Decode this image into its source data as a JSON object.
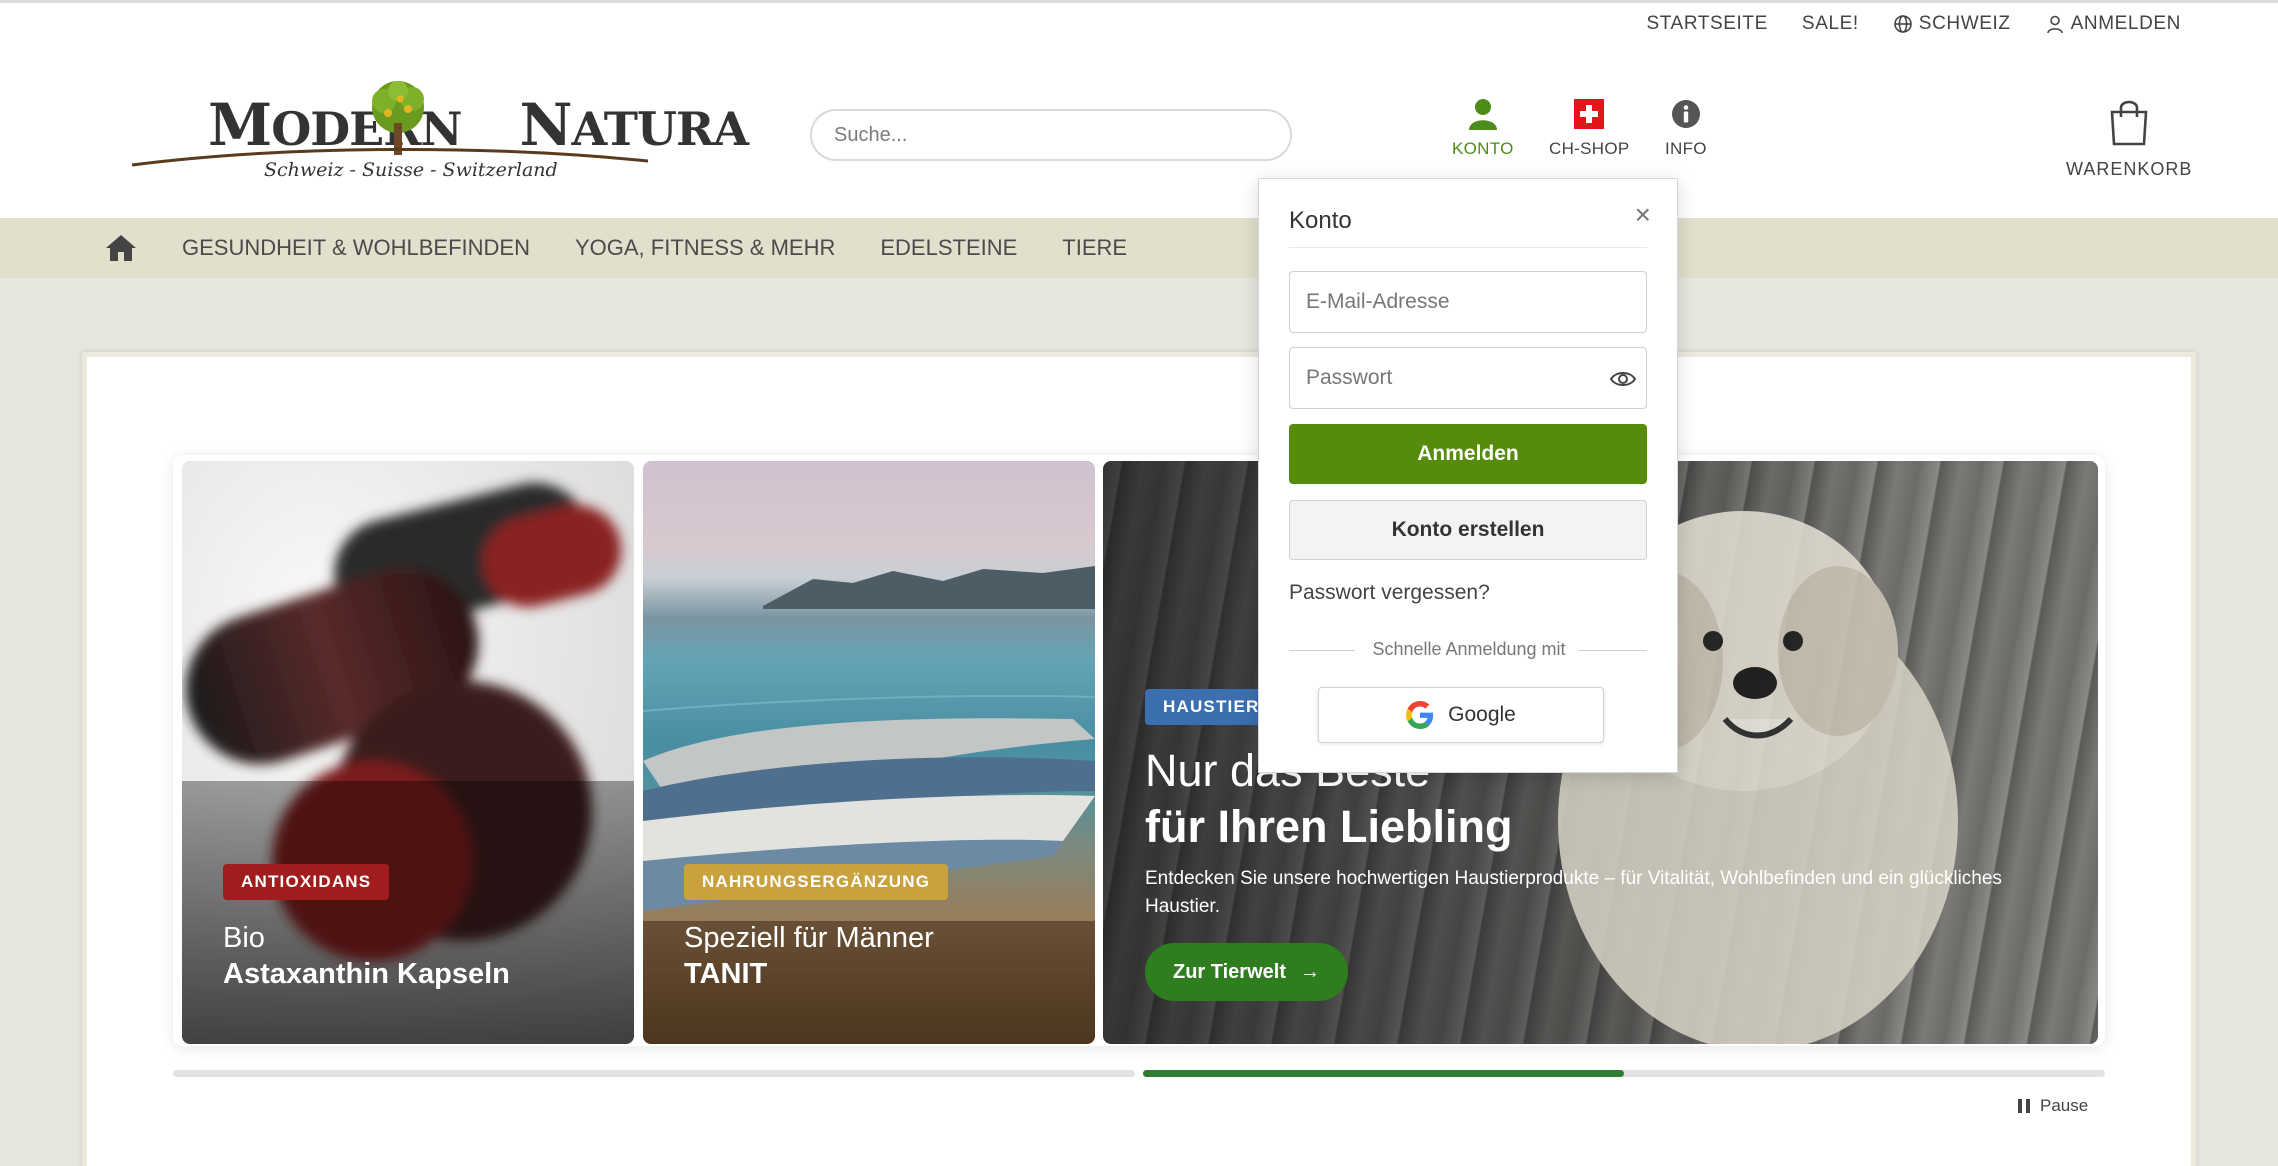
{
  "topbar": {
    "items": [
      {
        "label": "STARTSEITE",
        "icon": null
      },
      {
        "label": "SALE!",
        "icon": null
      },
      {
        "label": "SCHWEIZ",
        "icon": "globe-icon"
      },
      {
        "label": "ANMELDEN",
        "icon": "user-outline-icon"
      }
    ]
  },
  "logo": {
    "word1_cap": "M",
    "word1_rest": "ODERN",
    "word2_cap": "N",
    "word2_rest": "ATURA",
    "tagline": "Schweiz - Suisse - Switzerland"
  },
  "search": {
    "placeholder": "Suche..."
  },
  "header_icons": {
    "konto": {
      "label": "KONTO",
      "icon": "user-icon",
      "color": "#4b8c1a"
    },
    "chshop": {
      "label": "CH-SHOP",
      "icon": "swiss-flag-icon"
    },
    "info": {
      "label": "INFO",
      "icon": "info-icon"
    },
    "cart": {
      "label": "WARENKORB",
      "icon": "shopping-bag-icon"
    }
  },
  "nav": {
    "home_icon": "home-icon",
    "items": [
      "GESUNDHEIT & WOHLBEFINDEN",
      "YOGA, FITNESS & MEHR",
      "EDELSTEINE",
      "TIERE"
    ]
  },
  "slides": [
    {
      "badge": "ANTIOXIDANS",
      "badge_color": "#a11d1d",
      "line1": "Bio",
      "line2": "Astaxanthin Kapseln"
    },
    {
      "badge": "NAHRUNGSERGÄNZUNG",
      "badge_color": "#c9a23d",
      "line1": "Speziell für Männer",
      "line2": "TANIT"
    },
    {
      "badge": "HAUSTIER",
      "badge_color": "#3c6fb0",
      "line1": "Nur das Beste",
      "line2": "für Ihren Liebling",
      "text": "Entdecken Sie unsere hochwertigen Haustierprodukte – für Vitalität, Wohlbefinden und ein glückliches Haustier.",
      "cta": "Zur Tierwelt",
      "cta_arrow": "→",
      "cta_color": "#2e7d1f"
    }
  ],
  "progress": {
    "active_segment": 2,
    "active_fill": 0.5,
    "active_color": "#2e7d32"
  },
  "pause": {
    "label": "Pause",
    "icon": "pause-icon"
  },
  "popup": {
    "title": "Konto",
    "close": "×",
    "email_placeholder": "E-Mail-Adresse",
    "password_placeholder": "Passwort",
    "login_button": "Anmelden",
    "create_button": "Konto erstellen",
    "forgot": "Passwort vergessen?",
    "quick_login": "Schnelle Anmeldung mit",
    "google": "Google",
    "accent": "#568b0c"
  }
}
